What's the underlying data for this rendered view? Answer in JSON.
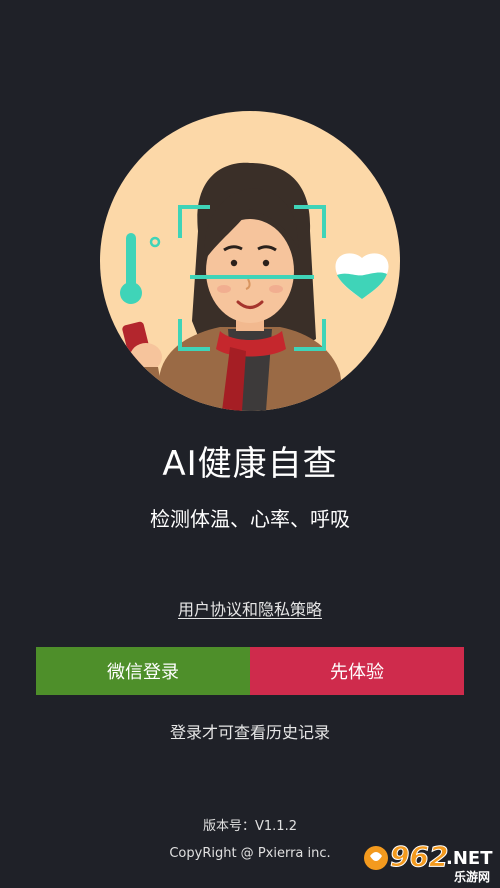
{
  "app": {
    "title": "AI健康自查",
    "subtitle": "检测体温、心率、呼吸"
  },
  "links": {
    "policy": "用户协议和隐私策略"
  },
  "buttons": {
    "wechat_login": "微信登录",
    "try_first": "先体验"
  },
  "hint": "登录才可查看历史记录",
  "footer": {
    "version_label": "版本号：",
    "version_value": "V1.1.2",
    "copyright": "CopyRight @ Pxierra inc."
  },
  "watermark": {
    "number": "962",
    "suffix": ".NET",
    "caption": "乐游网"
  },
  "colors": {
    "background": "#1f2128",
    "hero_circle": "#fcd8a8",
    "scan_frame": "#3fd4b8",
    "wechat_button": "#4e8f2a",
    "trial_button": "#cf2b4c"
  }
}
